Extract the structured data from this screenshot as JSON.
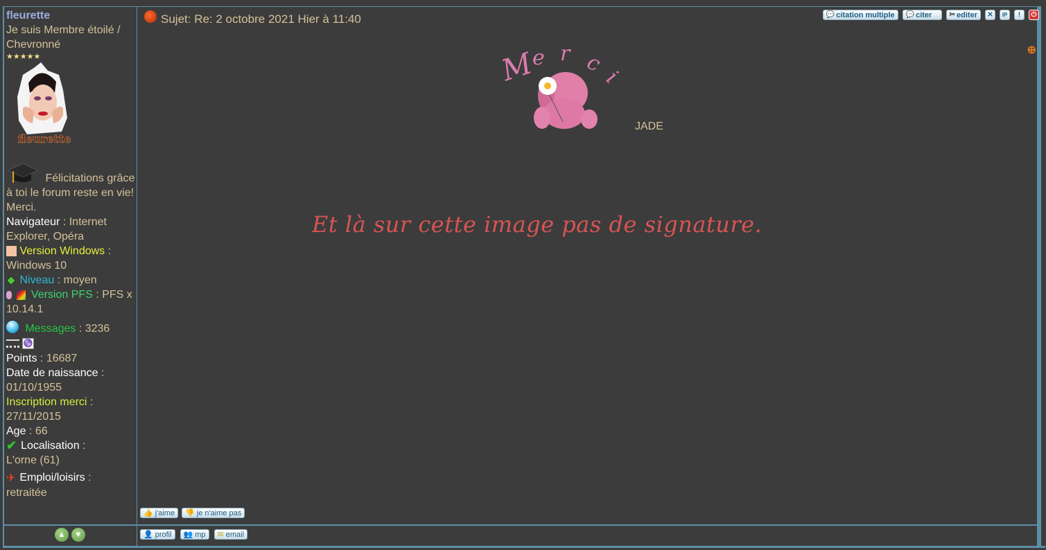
{
  "sidebar": {
    "username": "fleurette",
    "rank": "Je suis Membre étoilé / Chevronné",
    "stars": "★★★★★",
    "avatar_caption": "fleurette",
    "felicitations": "Félicitations grâce à toi le forum reste en vie! Merci.",
    "fields": {
      "navigateur_label": "Navigateur",
      "navigateur_value": "Internet Explorer, Opéra",
      "windows_label": "Version Windows",
      "windows_value": "Windows 10",
      "niveau_label": "Niveau",
      "niveau_value": "moyen",
      "pfs_label": "Version PFS",
      "pfs_value": "PFS x 10.14.1",
      "messages_label": "Messages",
      "messages_value": "3236",
      "points_label": "Points",
      "points_value": "16687",
      "naissance_label": "Date de naissance",
      "naissance_value": "01/10/1955",
      "inscription_label": "Inscription merci",
      "inscription_value": "27/11/2015",
      "age_label": "Age",
      "age_value": "66",
      "localisation_label": "Localisation",
      "localisation_value": "L'orne (61)",
      "emploi_label": "Emploi/loisirs",
      "emploi_value": "retraitée"
    },
    "separator": " : "
  },
  "post": {
    "title": "Sujet: Re: 2 octobre 2021 Hier à 11:40",
    "image_word": [
      "M",
      "e",
      "r",
      "c",
      "i"
    ],
    "signature_name": "JADE",
    "message": "Et là sur cette image pas de signature."
  },
  "toolbar": {
    "citation_multiple": "citation multiple",
    "citer": "citer",
    "editer": "editer",
    "delete": "✕",
    "ip": "IP",
    "report": "!",
    "warn": "⏻"
  },
  "reactions": {
    "like": "j'aime",
    "dislike": "je n'aime pas"
  },
  "footer": {
    "profil": "profil",
    "mp": "mp",
    "email": "email",
    "up": "▲",
    "down": "▼"
  }
}
